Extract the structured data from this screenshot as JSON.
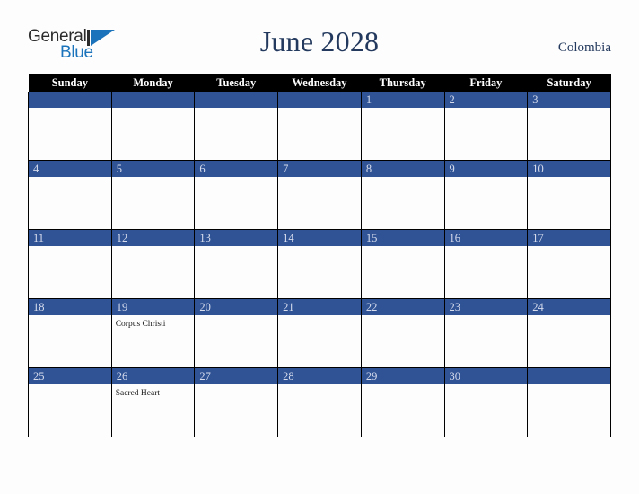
{
  "header": {
    "logo": {
      "word1": "General",
      "word2": "Blue",
      "triangle_icon": "triangle-icon"
    },
    "title": "June 2028",
    "country": "Colombia"
  },
  "colors": {
    "header_bg": "#000000",
    "day_bar": "#2f5395",
    "title_text": "#23395d",
    "logo_blue": "#1b74bb",
    "page_bg": "#fdfdfd",
    "grid_line": "#000000"
  },
  "calendar": {
    "weekday_headers": [
      "Sunday",
      "Monday",
      "Tuesday",
      "Wednesday",
      "Thursday",
      "Friday",
      "Saturday"
    ],
    "weeks": [
      [
        {
          "day": "",
          "events": []
        },
        {
          "day": "",
          "events": []
        },
        {
          "day": "",
          "events": []
        },
        {
          "day": "",
          "events": []
        },
        {
          "day": "1",
          "events": []
        },
        {
          "day": "2",
          "events": []
        },
        {
          "day": "3",
          "events": []
        }
      ],
      [
        {
          "day": "4",
          "events": []
        },
        {
          "day": "5",
          "events": []
        },
        {
          "day": "6",
          "events": []
        },
        {
          "day": "7",
          "events": []
        },
        {
          "day": "8",
          "events": []
        },
        {
          "day": "9",
          "events": []
        },
        {
          "day": "10",
          "events": []
        }
      ],
      [
        {
          "day": "11",
          "events": []
        },
        {
          "day": "12",
          "events": []
        },
        {
          "day": "13",
          "events": []
        },
        {
          "day": "14",
          "events": []
        },
        {
          "day": "15",
          "events": []
        },
        {
          "day": "16",
          "events": []
        },
        {
          "day": "17",
          "events": []
        }
      ],
      [
        {
          "day": "18",
          "events": []
        },
        {
          "day": "19",
          "events": [
            "Corpus Christi"
          ]
        },
        {
          "day": "20",
          "events": []
        },
        {
          "day": "21",
          "events": []
        },
        {
          "day": "22",
          "events": []
        },
        {
          "day": "23",
          "events": []
        },
        {
          "day": "24",
          "events": []
        }
      ],
      [
        {
          "day": "25",
          "events": []
        },
        {
          "day": "26",
          "events": [
            "Sacred Heart"
          ]
        },
        {
          "day": "27",
          "events": []
        },
        {
          "day": "28",
          "events": []
        },
        {
          "day": "29",
          "events": []
        },
        {
          "day": "30",
          "events": []
        },
        {
          "day": "",
          "events": []
        }
      ]
    ]
  }
}
